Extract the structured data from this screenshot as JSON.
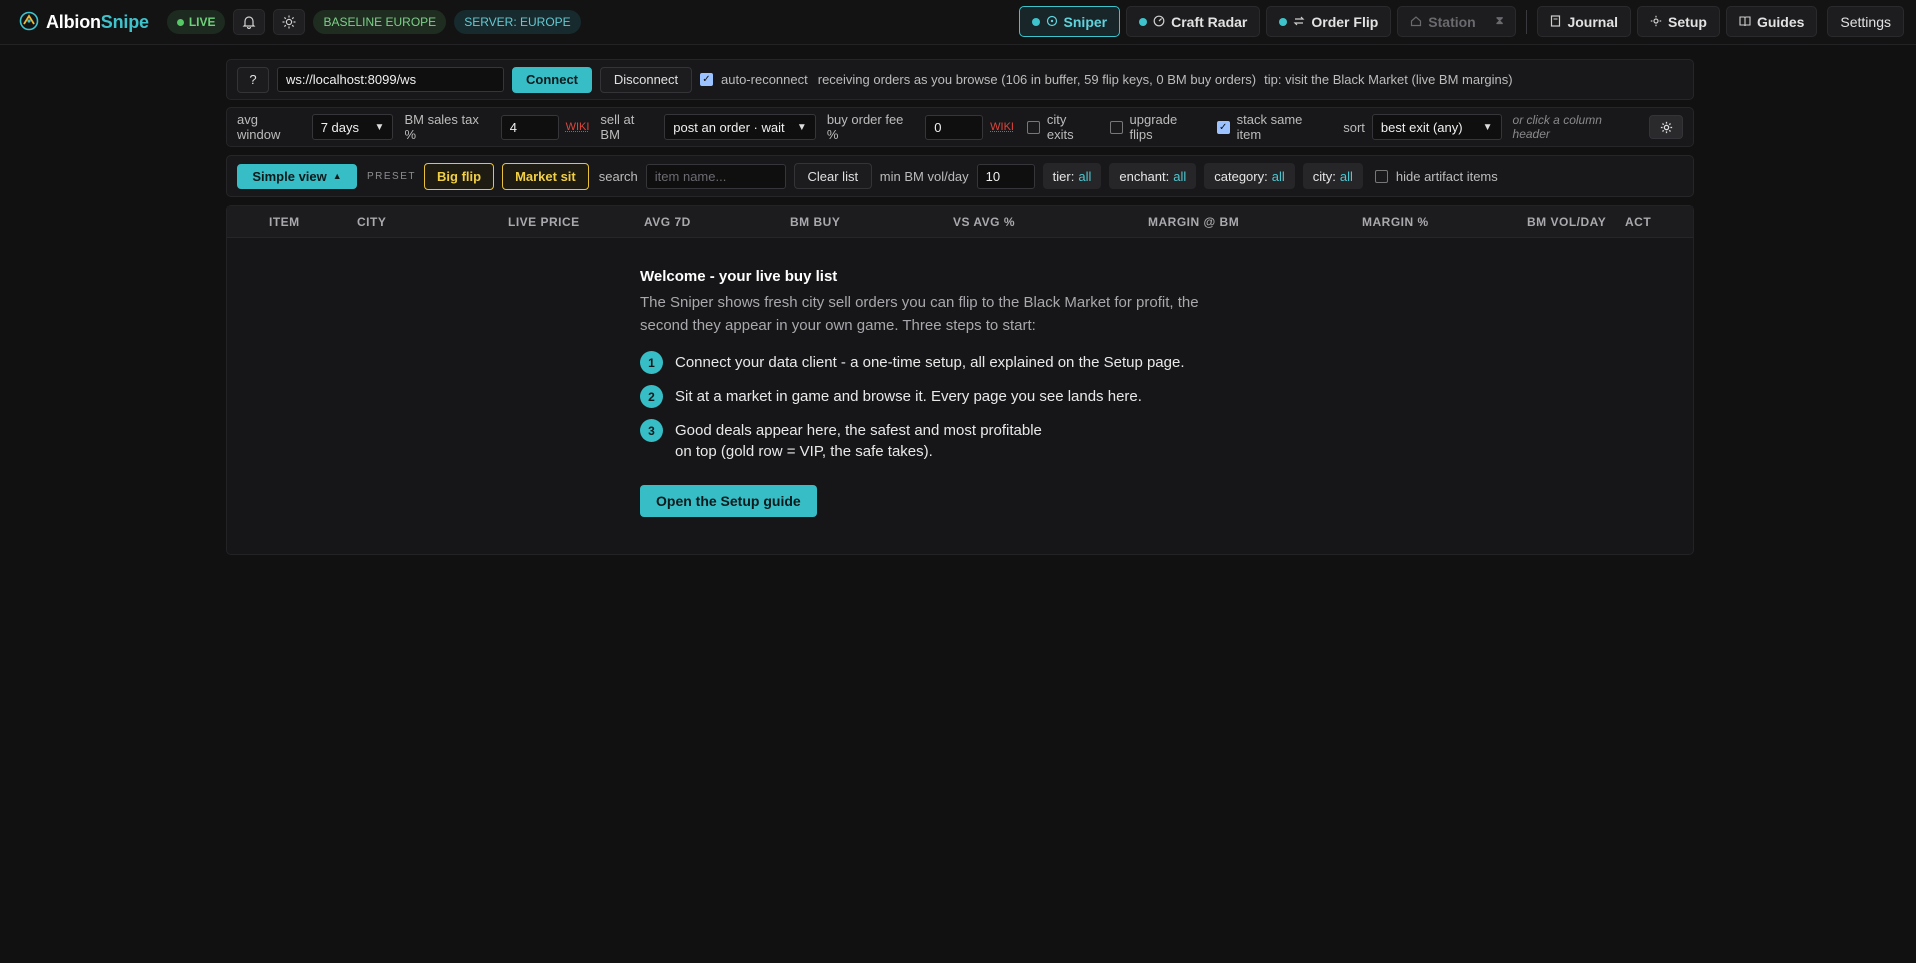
{
  "header": {
    "logo": {
      "part1": "Albion",
      "part2": "Snipe"
    },
    "live_label": "LIVE",
    "baseline_label": "BASELINE EUROPE",
    "server_label": "SERVER: EUROPE",
    "nav": {
      "sniper": "Sniper",
      "craft_radar": "Craft Radar",
      "order_flip": "Order Flip",
      "station": "Station",
      "journal": "Journal",
      "setup": "Setup",
      "guides": "Guides",
      "settings": "Settings"
    }
  },
  "connection": {
    "help_label": "?",
    "ws_url": "ws://localhost:8099/ws",
    "connect_label": "Connect",
    "disconnect_label": "Disconnect",
    "auto_reconnect_label": "auto-reconnect",
    "auto_reconnect_checked": true,
    "status_text": "receiving orders as you browse (106 in buffer, 59 flip keys, 0 BM buy orders)",
    "tip_text": "tip: visit the Black Market (live BM margins)"
  },
  "settings_row": {
    "avg_window_label": "avg window",
    "avg_window_value": "7 days",
    "bm_tax_label": "BM sales tax %",
    "bm_tax_value": "4",
    "wiki_label": "WIKI",
    "sell_at_bm_label": "sell at BM",
    "sell_at_bm_value": "post an order · wait",
    "buy_fee_label": "buy order fee %",
    "buy_fee_value": "0",
    "city_exits_label": "city exits",
    "upgrade_flips_label": "upgrade flips",
    "stack_same_label": "stack same item",
    "sort_label": "sort",
    "sort_value": "best exit (any)",
    "column_hint": "or click a column header"
  },
  "filters": {
    "view_label": "Simple view",
    "preset_label": "PRESET",
    "preset_big_flip": "Big flip",
    "preset_market_sit": "Market sit",
    "search_label": "search",
    "search_placeholder": "item name...",
    "clear_label": "Clear list",
    "min_vol_label": "min BM vol/day",
    "min_vol_value": "10",
    "tier_label": "tier:",
    "tier_value": "all",
    "enchant_label": "enchant:",
    "enchant_value": "all",
    "category_label": "category:",
    "category_value": "all",
    "city_label": "city:",
    "city_value": "all",
    "hide_artifact_label": "hide artifact items"
  },
  "table": {
    "columns": [
      "ITEM",
      "CITY",
      "LIVE PRICE",
      "AVG 7D",
      "BM BUY",
      "VS AVG %",
      "MARGIN @ BM",
      "MARGIN %",
      "BM VOL/DAY",
      "ACT"
    ]
  },
  "welcome": {
    "title": "Welcome - your live buy list",
    "intro": "The Sniper shows fresh city sell orders you can flip to the Black Market for profit, the second they appear in your own game. Three steps to start:",
    "steps": [
      {
        "num": "1",
        "text": "Connect your data client - a one-time setup, all explained on the Setup page."
      },
      {
        "num": "2",
        "text": "Sit at a market in game and browse it. Every page you see lands here."
      },
      {
        "num": "3",
        "text": "Good deals appear here, the safest and most profitable on top (gold row = VIP, the safe takes)."
      }
    ],
    "setup_button": "Open the Setup guide"
  },
  "colors": {
    "accent": "#37bdc5",
    "preset": "#f1cf45",
    "live": "#57c767",
    "wiki": "#e0453b"
  }
}
